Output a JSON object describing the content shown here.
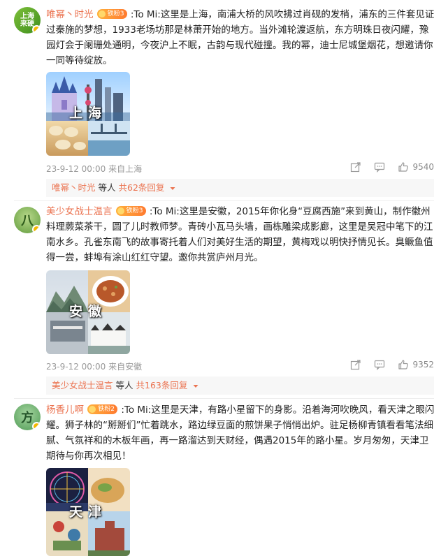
{
  "comments": [
    {
      "avatar_text": "上海\n来硬",
      "user": "唯幂丶时光",
      "fan_badge": "铁粉3",
      "body": ":To Mi:这里是上海，南浦大桥的风吹拂过肖砚的发梢，浦东的三件套见证过秦施的梦想，1933老场坊那是林萧开始的地方。当外滩轮渡返航，东方明珠日夜闪耀，豫园灯会于阑珊处通明，今夜沪上不眠，古韵与现代碰撞。我的幂，迪士尼城堡烟花，想邀请你一同等待绽放。",
      "image_label": "上海",
      "date": "23-9-12 00:00",
      "source": "来自上海",
      "likes": "9540",
      "reply_user": "唯幂丶时光",
      "reply_mid": "等人",
      "reply_count": "共62条回复"
    },
    {
      "avatar_text": "八",
      "user": "美少女战士温言",
      "fan_badge": "铁粉3",
      "body": ":To Mi:这里是安徽，2015年你化身“豆腐西施”来到黄山，制作徽州料理蕨菜茶干，圆了儿时教师梦。青砖小瓦马头墙，画栋雕梁成影廊，这里是吴冠中笔下的江南水乡。孔雀东南飞的故事寄托着人们对美好生活的期望，黄梅戏以明快抒情见长。臭鳜鱼值得一尝，蚌埠有涂山红红守望。邀你共赏庐州月光。",
      "image_label": "安徽",
      "date": "23-9-12 00:00",
      "source": "来自安徽",
      "likes": "9352",
      "reply_user": "美少女战士温言",
      "reply_mid": "等人",
      "reply_count": "共163条回复"
    },
    {
      "avatar_text": "方",
      "user": "杨香儿啊",
      "fan_badge": "铁粉2",
      "body": ":To Mi:这里是天津，有路小星留下的身影。沿着海河吹晚风，看天津之眼闪耀。狮子林的“掰掰们”忙着跳水，路边绿豆面的煎饼果子悄悄出炉。驻足杨柳青镇看看笔法细腻、气氛祥和的木板年画，再一路溜达到天财经，偶遇2015年的路小星。岁月匆匆，天津卫期待与你再次相见！",
      "image_label": "天津",
      "date": "",
      "source": "",
      "likes": "",
      "reply_user": "",
      "reply_mid": "",
      "reply_count": ""
    }
  ],
  "colors": {
    "username": "#eb7350",
    "meta": "#999999",
    "badge": "#ff9933"
  },
  "icons": {
    "share": "share-icon",
    "comment": "comment-icon",
    "like": "like-icon",
    "expand": "chevron-down-icon"
  }
}
